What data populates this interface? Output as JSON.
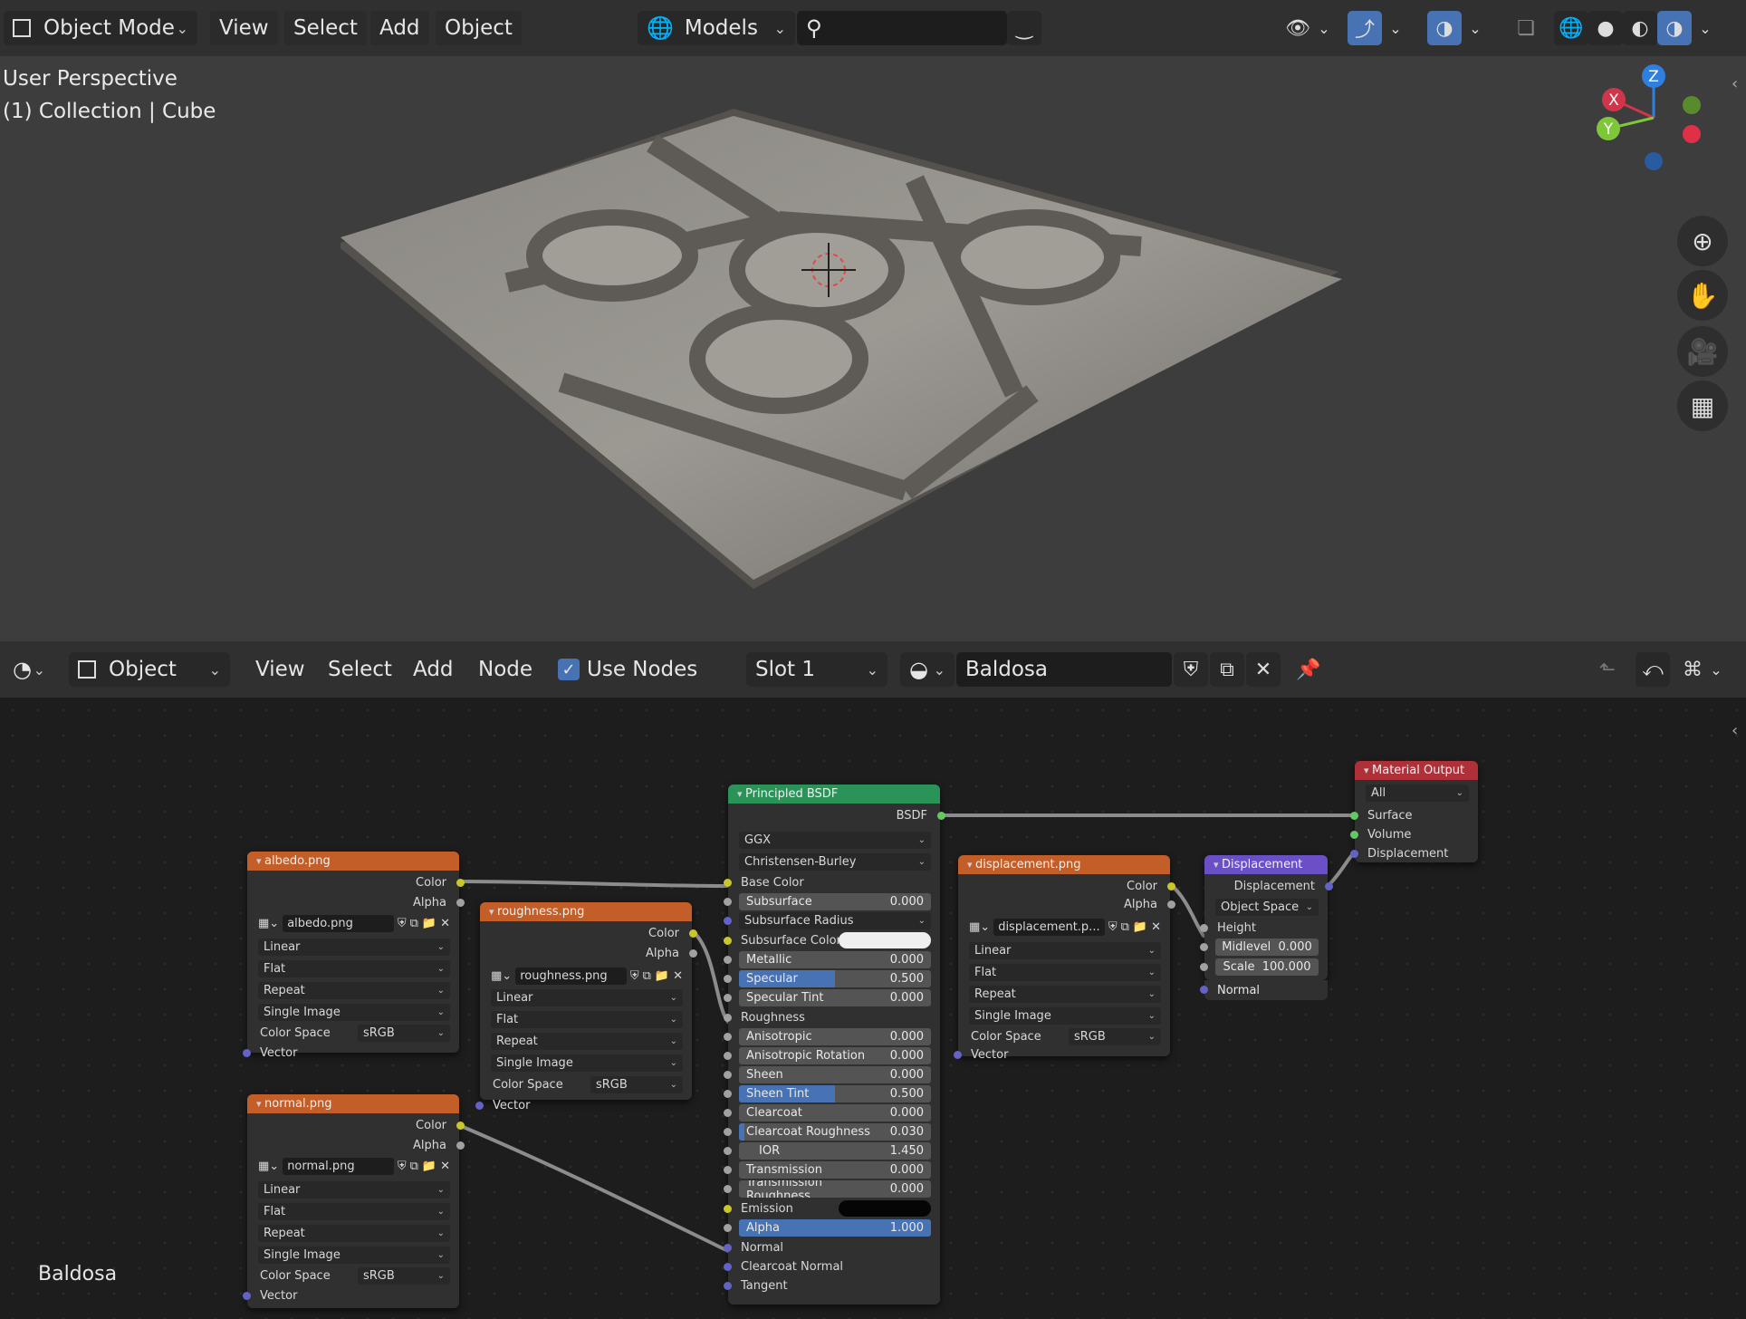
{
  "viewport_header": {
    "mode": "Object Mode",
    "menus": [
      "View",
      "Select",
      "Add",
      "Object"
    ],
    "collection_selector": "Models",
    "search_placeholder": ""
  },
  "viewport": {
    "perspective_label": "User Perspective",
    "collection_label": "(1) Collection | Cube",
    "gizmo_axes": [
      "Z",
      "X",
      "Y"
    ]
  },
  "node_header": {
    "editor_mode": "Object",
    "menus": [
      "View",
      "Select",
      "Add",
      "Node"
    ],
    "use_nodes_label": "Use Nodes",
    "use_nodes_checked": true,
    "slot": "Slot 1",
    "material_name": "Baldosa"
  },
  "node_editor": {
    "material_label": "Baldosa"
  },
  "nodes": {
    "albedo": {
      "title": "albedo.png",
      "outputs": [
        "Color",
        "Alpha"
      ],
      "image": "albedo.png",
      "interpolation": "Linear",
      "projection": "Flat",
      "extension": "Repeat",
      "source": "Single Image",
      "color_space_label": "Color Space",
      "color_space": "sRGB",
      "input": "Vector"
    },
    "normal": {
      "title": "normal.png",
      "outputs": [
        "Color",
        "Alpha"
      ],
      "image": "normal.png",
      "interpolation": "Linear",
      "projection": "Flat",
      "extension": "Repeat",
      "source": "Single Image",
      "color_space_label": "Color Space",
      "color_space": "sRGB",
      "input": "Vector"
    },
    "roughness": {
      "title": "roughness.png",
      "outputs": [
        "Color",
        "Alpha"
      ],
      "image": "roughness.png",
      "interpolation": "Linear",
      "projection": "Flat",
      "extension": "Repeat",
      "source": "Single Image",
      "color_space_label": "Color Space",
      "color_space": "sRGB",
      "input": "Vector"
    },
    "bsdf": {
      "title": "Principled BSDF",
      "output": "BSDF",
      "distribution": "GGX",
      "subsurface_method": "Christensen-Burley",
      "base_color": "Base Color",
      "subsurface": {
        "label": "Subsurface",
        "value": "0.000"
      },
      "subsurface_radius": "Subsurface Radius",
      "subsurface_color": "Subsurface Color",
      "metallic": {
        "label": "Metallic",
        "value": "0.000"
      },
      "specular": {
        "label": "Specular",
        "value": "0.500",
        "fill": 0.5
      },
      "specular_tint": {
        "label": "Specular Tint",
        "value": "0.000"
      },
      "roughness": "Roughness",
      "anisotropic": {
        "label": "Anisotropic",
        "value": "0.000"
      },
      "anisotropic_rotation": {
        "label": "Anisotropic Rotation",
        "value": "0.000"
      },
      "sheen": {
        "label": "Sheen",
        "value": "0.000"
      },
      "sheen_tint": {
        "label": "Sheen Tint",
        "value": "0.500",
        "fill": 0.5
      },
      "clearcoat": {
        "label": "Clearcoat",
        "value": "0.000"
      },
      "clearcoat_roughness": {
        "label": "Clearcoat Roughness",
        "value": "0.030",
        "fill": 0.03
      },
      "ior": {
        "label": "IOR",
        "value": "1.450"
      },
      "transmission": {
        "label": "Transmission",
        "value": "0.000"
      },
      "transmission_roughness": {
        "label": "Transmission Roughness",
        "value": "0.000"
      },
      "emission": "Emission",
      "alpha": {
        "label": "Alpha",
        "value": "1.000",
        "fill": 1.0
      },
      "normal": "Normal",
      "clearcoat_normal": "Clearcoat Normal",
      "tangent": "Tangent"
    },
    "displacement_tex": {
      "title": "displacement.png",
      "outputs": [
        "Color",
        "Alpha"
      ],
      "image": "displacement.p...",
      "interpolation": "Linear",
      "projection": "Flat",
      "extension": "Repeat",
      "source": "Single Image",
      "color_space_label": "Color Space",
      "color_space": "sRGB",
      "input": "Vector"
    },
    "displacement": {
      "title": "Displacement",
      "output": "Displacement",
      "space": "Object Space",
      "height": "Height",
      "midlevel": {
        "label": "Midlevel",
        "value": "0.000"
      },
      "scale": {
        "label": "Scale",
        "value": "100.000"
      },
      "normal": "Normal"
    },
    "output": {
      "title": "Material Output",
      "target": "All",
      "inputs": [
        "Surface",
        "Volume",
        "Displacement"
      ]
    }
  },
  "colors": {
    "header_bg": "#303030",
    "accent": "#4772b3",
    "texture_node": "#c35e28",
    "shader_node": "#2a9458",
    "output_node": "#b0303a",
    "vector_node": "#6a4fc7"
  }
}
